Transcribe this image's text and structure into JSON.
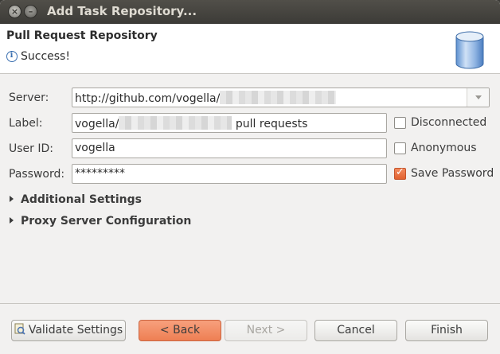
{
  "window": {
    "title": "Add Task Repository..."
  },
  "header": {
    "page_title": "Pull Request Repository",
    "message": "Success!",
    "message_icon": "info-icon",
    "banner_icon": "database-icon"
  },
  "form": {
    "server": {
      "label": "Server:",
      "value_prefix": "http://github.com/vogella/"
    },
    "label_field": {
      "label": "Label:",
      "value_prefix": "vogella/",
      "value_suffix": "pull requests"
    },
    "user_id": {
      "label": "User ID:",
      "value": "vogella"
    },
    "password": {
      "label": "Password:",
      "value": "*********"
    },
    "disconnected": {
      "label": "Disconnected",
      "checked": false
    },
    "anonymous": {
      "label": "Anonymous",
      "checked": false
    },
    "save_password": {
      "label": "Save Password",
      "checked": true
    }
  },
  "sections": {
    "additional_settings": "Additional Settings",
    "proxy_config": "Proxy Server Configuration"
  },
  "buttons": {
    "validate": "Validate Settings",
    "back": "< Back",
    "next": "Next >",
    "cancel": "Cancel",
    "finish": "Finish"
  },
  "colors": {
    "accent": "#ee7f53",
    "titlebar": "#3c3b37",
    "dialog_bg": "#f2f1f0"
  }
}
